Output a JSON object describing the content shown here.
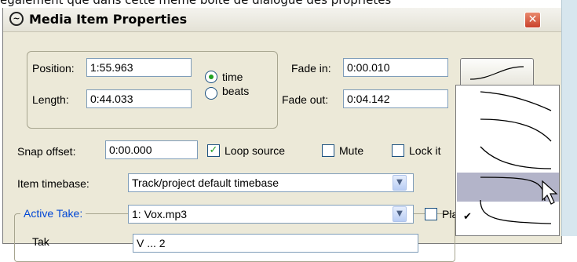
{
  "caption": "également que dans cette même boite de dialogue des propriétés",
  "window": {
    "title": "Media Item Properties",
    "close_glyph": "✕"
  },
  "position": {
    "label": "Position:",
    "value": "1:55.963"
  },
  "length": {
    "label": "Length:",
    "value": "0:44.033"
  },
  "timebase_radio": {
    "time_label": "time",
    "beats_label": "beats",
    "selected": "time"
  },
  "fade_in": {
    "label": "Fade in:",
    "value": "0:00.010"
  },
  "fade_out": {
    "label": "Fade out:",
    "value": "0:04.142"
  },
  "snap_offset": {
    "label": "Snap offset:",
    "value": "0:00.000"
  },
  "loop_source": {
    "label": "Loop source",
    "checked": true
  },
  "mute": {
    "label": "Mute",
    "checked": false
  },
  "lock": {
    "label": "Lock it",
    "checked": false
  },
  "item_timebase": {
    "label": "Item timebase:",
    "value": "Track/project default timebase"
  },
  "active_take": {
    "label": "Active Take:",
    "value": "1: Vox.mp3"
  },
  "play_checkbox": {
    "label": "Pla",
    "checked": false
  },
  "take_partial": {
    "label": "Tak",
    "value": "V  ...  2"
  },
  "fade_shape_menu": {
    "items": [
      {
        "shape": "fade-shape-1"
      },
      {
        "shape": "fade-shape-2"
      },
      {
        "shape": "fade-shape-3"
      },
      {
        "shape": "fade-shape-4",
        "highlighted": true
      },
      {
        "shape": "fade-shape-5",
        "checked": true
      }
    ],
    "checkmark": "✔"
  },
  "colors": {
    "dialog_bg": "#ece9d8",
    "highlight": "#b3b4c9",
    "active_take_label": "#0046d5"
  }
}
